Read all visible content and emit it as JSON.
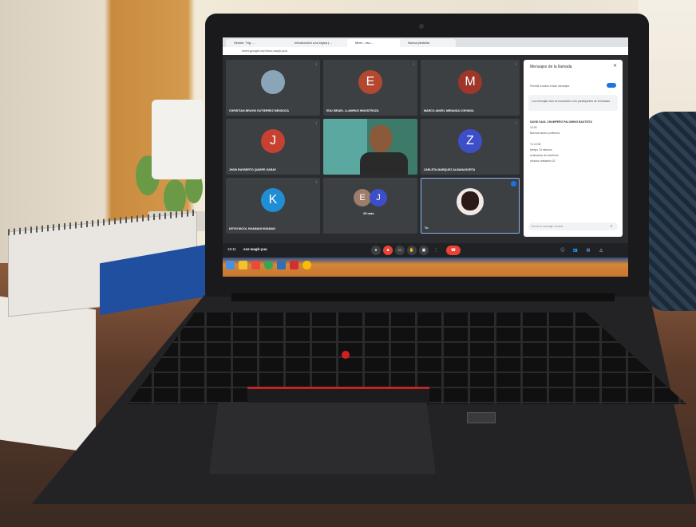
{
  "browser": {
    "tabs": [
      "Sesión: Trig. ...",
      "Introducción a la lógica (...",
      "Meet - esz-...",
      "Nueva pestaña"
    ],
    "url": "meet.google.com/esz-wagh-yua"
  },
  "meeting": {
    "code": "esz-wagh-yua",
    "time": "16:11",
    "participants": [
      {
        "name": "CHRISTIAN BRAYIN GUTIERREZ MENDOZA",
        "type": "photo"
      },
      {
        "name": "EDU ISRAEL LLAMPASI HINOSTROZA",
        "initial": "E",
        "color": "#b3472f"
      },
      {
        "name": "MARCO ANGEL MIRANDA CORINGA",
        "initial": "M",
        "color": "#a0362a"
      },
      {
        "name": "JHON RAYBERTO QUISPE GARAY",
        "initial": "J",
        "color": "#c64132"
      },
      {
        "name": "",
        "type": "video"
      },
      {
        "name": "ZARLETA MARQUEZ ALBANAGORTA",
        "initial": "Z",
        "color": "#3c4fc9"
      },
      {
        "name": "KEYSI NICOL HUAMANI HUAMAN",
        "initial": "K",
        "color": "#1f8ed4"
      },
      {
        "name": "25 más",
        "initials": [
          "E",
          "J"
        ]
      },
      {
        "name": "Tú",
        "type": "self"
      }
    ]
  },
  "chat_panel": {
    "title": "Mensajes de la llamada",
    "close_icon": "close-icon",
    "toggle_label": "Permitir a todos enviar mensajes",
    "notice": "Los mensajes solo se mostrarán a los participantes de la llamada",
    "messages": [
      "DAVID SAUL CHAMPERO PALOMINO BAUTISTA",
      "10:05",
      "Buenas tardes profesora",
      "Tú  10:08",
      "tiempo 10 minutos",
      "evaluación de escritorio",
      "minutos restantes 02"
    ],
    "input_placeholder": "Envía un mensaje a todos"
  },
  "controls": [
    "mic-icon",
    "camera-off-icon",
    "captions-icon",
    "hand-icon",
    "present-icon",
    "more-icon",
    "end-call-icon"
  ],
  "right_controls": [
    "info-icon",
    "people-icon",
    "chat-icon",
    "activities-icon"
  ]
}
